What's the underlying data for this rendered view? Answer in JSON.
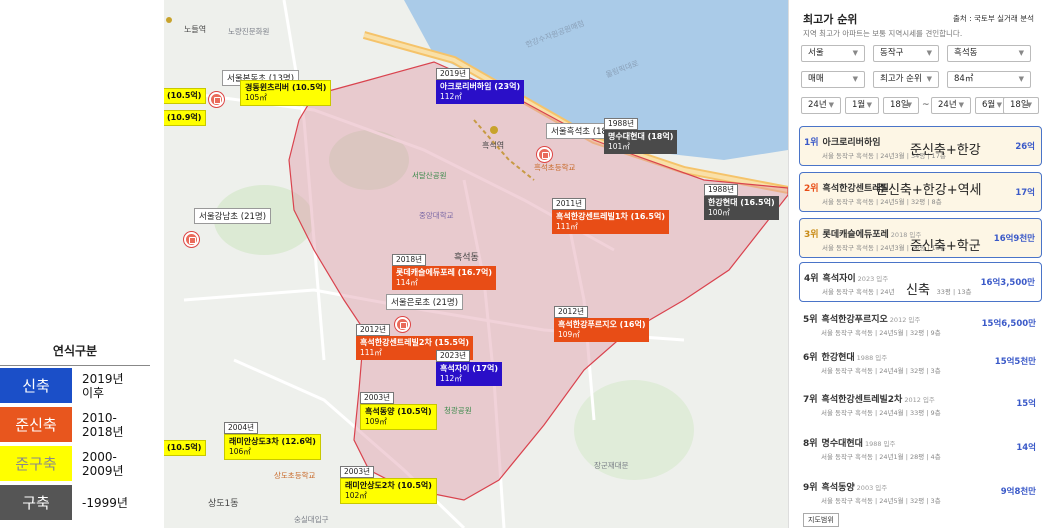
{
  "legend": {
    "title": "연식구분",
    "items": [
      {
        "label": "신축",
        "range": "2019년\n이후",
        "color": "#1b4fc8",
        "text_color": "#ffffff"
      },
      {
        "label": "준신축",
        "range": "2010-\n2018년",
        "color": "#e8561e",
        "text_color": "#ffffff"
      },
      {
        "label": "준구축",
        "range": "2000-\n2009년",
        "color": "#ffff00",
        "text_color": "#8a8a8a"
      },
      {
        "label": "구축",
        "range": "-1999년",
        "color": "#555555",
        "text_color": "#ffffff"
      }
    ]
  },
  "map": {
    "offices": [
      "서울본동초 (13명)",
      "서울흑석초 (18명)",
      "서울강남초 (21명)",
      "서울은로초 (21명)"
    ],
    "labels": {
      "noryang_station": "노들역",
      "noryang_market": "노량진문화원",
      "apt_kyungdong": "경동윈츠리버",
      "hangang_road": "한강수자원공원매점",
      "olympic": "올림픽대로",
      "heukseok_station": "흑석역",
      "heukseok_dong": "흑석동",
      "seodal_park": "서달산공원",
      "jungang_univ": "중앙대학교",
      "heukseok_elem": "흑석초등학교",
      "sangdo_1dong": "상도1동",
      "sangdo_elem": "상도초등학교",
      "chunggwang": "청광공원",
      "jangseung": "장군재대문",
      "soongsil": "숭실대입구",
      "zoom": "지도범위"
    },
    "cards": [
      {
        "year": "",
        "name": "경동윈츠리버 (10.5억)",
        "area": "105㎡",
        "era": "semiold"
      },
      {
        "year": "2019년",
        "name": "아크로리버하임 (23억)",
        "area": "112㎡",
        "era": "new"
      },
      {
        "year": "1988년",
        "name": "명수대현대 (18억)",
        "area": "101㎡",
        "era": "old"
      },
      {
        "year": "1988년",
        "name": "한강현대 (16.5억)",
        "area": "100㎡",
        "era": "old"
      },
      {
        "year": "2011년",
        "name": "흑석한강센트레빌1차 (16.5억)",
        "area": "111㎡",
        "era": "semi"
      },
      {
        "year": "2018년",
        "name": "롯데캐슬에듀포레 (16.7억)",
        "area": "114㎡",
        "era": "semi"
      },
      {
        "year": "2012년",
        "name": "흑석한강센트레빌2차 (15.5억)",
        "area": "111㎡",
        "era": "semi"
      },
      {
        "year": "2012년",
        "name": "흑석한강푸르지오 (16억)",
        "area": "109㎡",
        "era": "semi"
      },
      {
        "year": "2023년",
        "name": "흑석자이 (17억)",
        "area": "112㎡",
        "era": "new"
      },
      {
        "year": "2003년",
        "name": "흑석동양 (10.5억)",
        "area": "109㎡",
        "era": "semiold"
      },
      {
        "year": "2004년",
        "name": "래미안상도3차 (12.6억)",
        "area": "106㎡",
        "era": "semiold"
      },
      {
        "year": "2003년",
        "name": "래미안상도2차 (10.5억)",
        "area": "102㎡",
        "era": "semiold"
      },
      {
        "year": "",
        "name": "(10.5억)",
        "area": "",
        "era": "semiold"
      },
      {
        "year": "",
        "name": "(10.9억)",
        "area": "",
        "era": "semiold"
      },
      {
        "year": "",
        "name": "(10.5억)",
        "area": "",
        "era": "semiold"
      }
    ]
  },
  "panel": {
    "title": "최고가 순위",
    "source": "출처 : 국토부 실거래 분석",
    "subtitle": "지역 최고가 아파트는 보통 지역시세를 견인합니다.",
    "filters": {
      "city": "서울",
      "district": "동작구",
      "dong": "흑석동",
      "trade": "매매",
      "sort": "최고가 순위",
      "size": "84㎡",
      "y1": "24년",
      "m1": "1월",
      "d1": "18일",
      "tilde": "~",
      "y2": "24년",
      "m2": "6월",
      "d2": "18일"
    },
    "ranks": [
      {
        "num": "1위",
        "name": "아크로리버하임",
        "yr": "",
        "detail": "서울 동작구 흑석동 | 24년3월 | 34평 | 17층",
        "price": "26억",
        "overlay": "준신축+한강"
      },
      {
        "num": "2위",
        "name": "흑석한강센트레빌",
        "yr": "",
        "detail": "서울 동작구 흑석동 | 24년5월 | 32평 | 8층",
        "price": "17억",
        "overlay": "준신축+한강+역세"
      },
      {
        "num": "3위",
        "name": "롯데캐슬에듀포레",
        "yr": "2018 입주",
        "detail": "서울 동작구 흑석동 | 24년3월 | 33평 | 13층",
        "price": "16억9천만",
        "overlay": "준신축+학군"
      },
      {
        "num": "4위",
        "name": "흑석자이",
        "yr": "2023 입주",
        "detail": "서울 동작구 흑석동 | 24년",
        "detail2": "33평 | 13층",
        "price": "16억3,500만",
        "overlay": "신축"
      },
      {
        "num": "5위",
        "name": "흑석한강푸르지오",
        "yr": "2012 입주",
        "detail": "서울 동작구 흑석동 | 24년5월 | 32평 | 9층",
        "price": "15억6,500만",
        "overlay": ""
      },
      {
        "num": "6위",
        "name": "한강현대",
        "yr": "1988 입주",
        "detail": "서울 동작구 흑석동 | 24년4월 | 32평 | 3층",
        "price": "15억5천만",
        "overlay": ""
      },
      {
        "num": "7위",
        "name": "흑석한강센트레빌2차",
        "yr": "2012 입주",
        "detail": "서울 동작구 흑석동 | 24년4월 | 33평 | 9층",
        "price": "15억",
        "overlay": ""
      },
      {
        "num": "8위",
        "name": "명수대현대",
        "yr": "1988 입주",
        "detail": "서울 동작구 흑석동 | 24년1월 | 28평 | 4층",
        "price": "14억",
        "overlay": ""
      },
      {
        "num": "9위",
        "name": "흑석동양",
        "yr": "2003 입주",
        "detail": "서울 동작구 흑석동 | 24년5월 | 32평 | 3층",
        "price": "9억8천만",
        "overlay": ""
      }
    ],
    "zoom_label": "지도범위"
  }
}
